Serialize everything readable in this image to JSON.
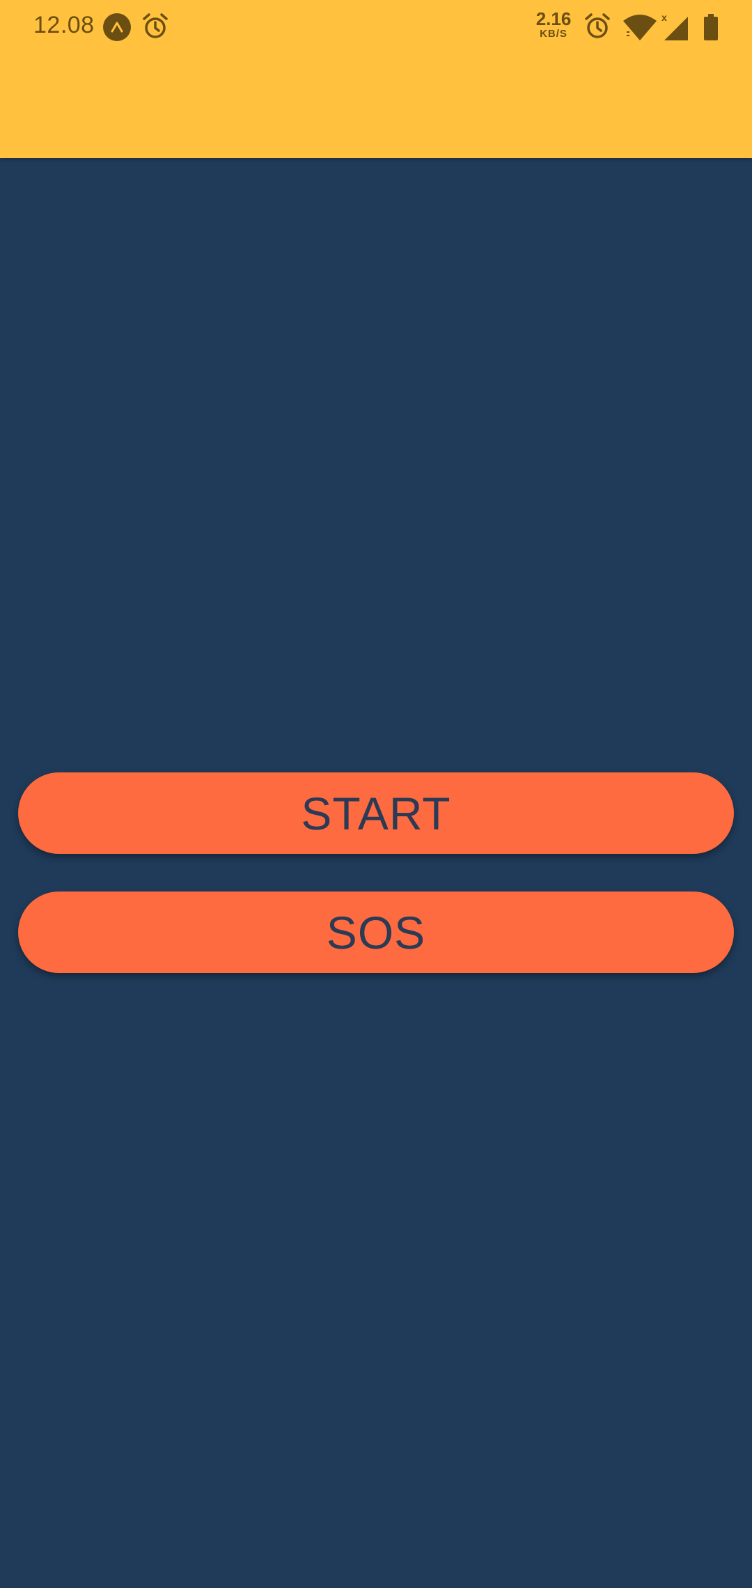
{
  "status_bar": {
    "time": "12.08",
    "net_speed_value": "2.16",
    "net_speed_unit": "KB/S",
    "icons": [
      "expo-icon",
      "alarm-icon",
      "alarm-icon",
      "wifi-icon",
      "cell-signal-icon",
      "battery-icon"
    ],
    "color": "#6b4e12",
    "background": "#ffc13e"
  },
  "main": {
    "background": "#1f3b59",
    "start_label": "START",
    "sos_label": "SOS",
    "button_color": "#ff6b40",
    "button_text_color": "#2b3a55"
  }
}
